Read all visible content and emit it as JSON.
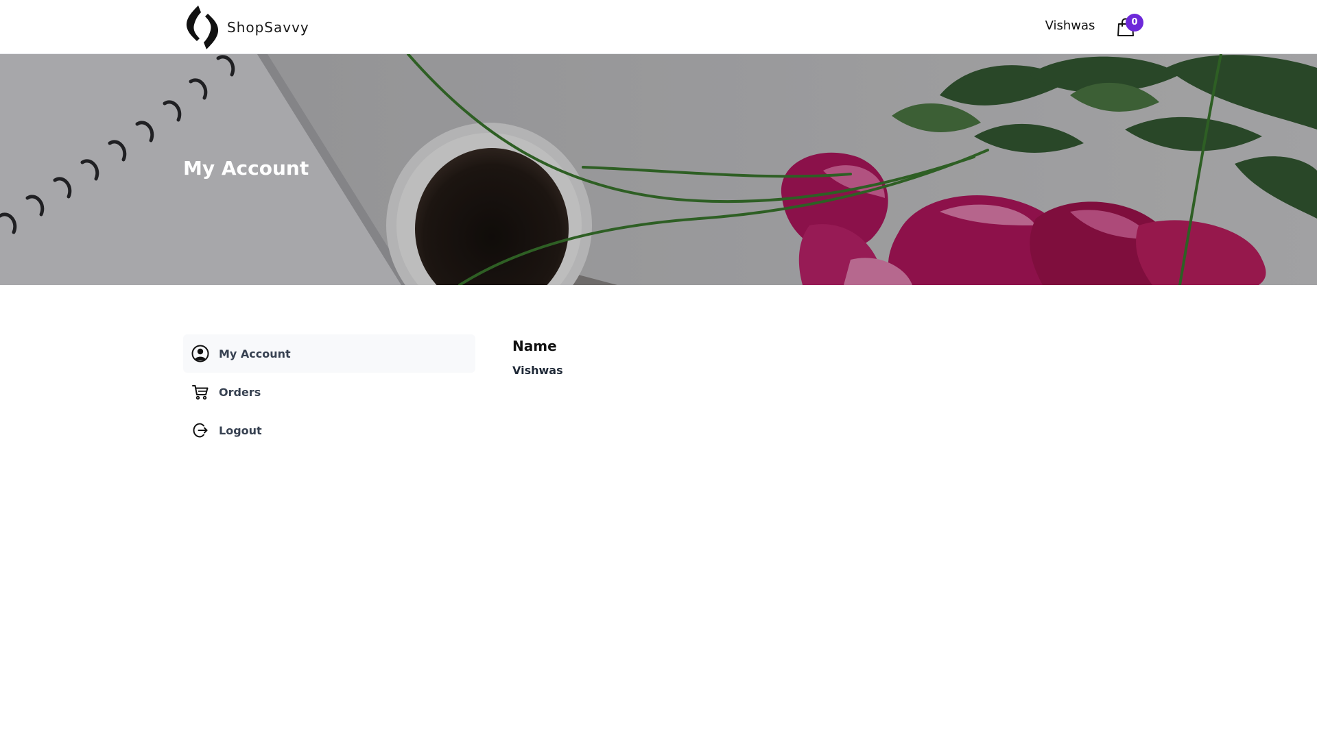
{
  "brand": {
    "name": "ShopSavvy",
    "logo_icon": "brand-logo-mark"
  },
  "header": {
    "user_name": "Vishwas",
    "cart": {
      "icon": "shopping-bag-icon",
      "count": "0",
      "badge_color": "#6d28d9"
    }
  },
  "hero": {
    "title": "My Account"
  },
  "sidebar": {
    "items": [
      {
        "label": "My Account",
        "icon": "user-circle-icon",
        "active": true
      },
      {
        "label": "Orders",
        "icon": "cart-icon",
        "active": false
      },
      {
        "label": "Logout",
        "icon": "logout-icon",
        "active": false
      }
    ]
  },
  "profile": {
    "name_label": "Name",
    "name_value": "Vishwas"
  },
  "colors": {
    "accent": "#6d28d9",
    "active_bg": "#f8f9fb",
    "text": "#111111",
    "muted_text": "#374151"
  }
}
